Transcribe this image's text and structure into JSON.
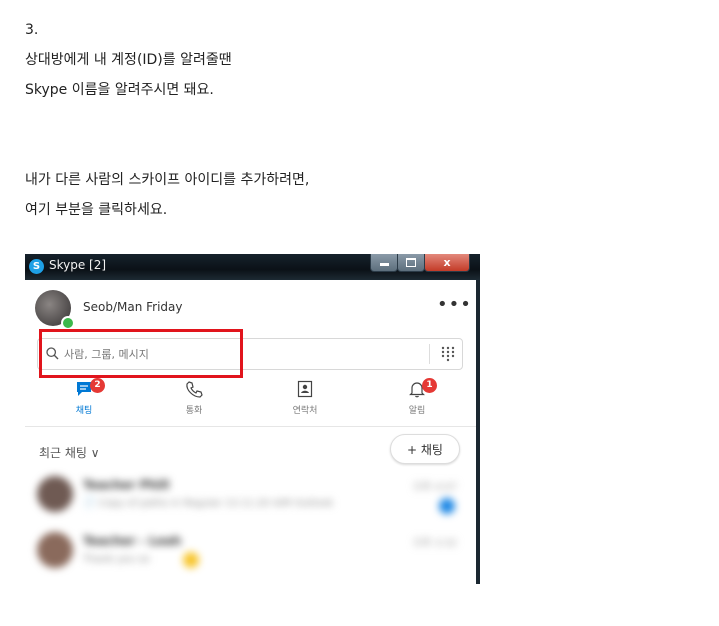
{
  "text": {
    "step": "3.",
    "line1": "상대방에게 내 계정(ID)를 알려줄땐",
    "line2": "Skype 이름을 알려주시면 돼요.",
    "line3": "내가 다른 사람의 스카이프 아이디를 추가하려면,",
    "line4": "여기 부분을 클릭하세요."
  },
  "skype": {
    "window_title": "Skype [2]",
    "logo_letter": "S",
    "close_symbol": "x",
    "profile_name": "Seob/Man Friday",
    "more_symbol": "•••",
    "search_placeholder": "사람, 그룹, 메시지",
    "tabs": [
      {
        "label": "채팅",
        "badge": "2",
        "icon": "chat-icon",
        "active": true
      },
      {
        "label": "통화",
        "badge": "",
        "icon": "phone-icon",
        "active": false
      },
      {
        "label": "연락처",
        "badge": "",
        "icon": "contacts-icon",
        "active": false
      },
      {
        "label": "알림",
        "badge": "1",
        "icon": "bell-icon",
        "active": false
      }
    ],
    "recent_label": "최근 채팅 ∨",
    "new_chat_label": "+ 채팅",
    "chats": [
      {
        "name": "Teacher Phill",
        "message": "📄 Copy of paths in Regular 13.11.20 4/M Outlook",
        "time": "오후 4:07"
      },
      {
        "name": "Teacher - Leah",
        "message": "Thank you so",
        "time": "오후 3:32"
      }
    ],
    "colors": {
      "accent": "#0078d4",
      "badge": "#e53935",
      "highlight": "#e1141c",
      "online": "#3cb84b"
    }
  }
}
